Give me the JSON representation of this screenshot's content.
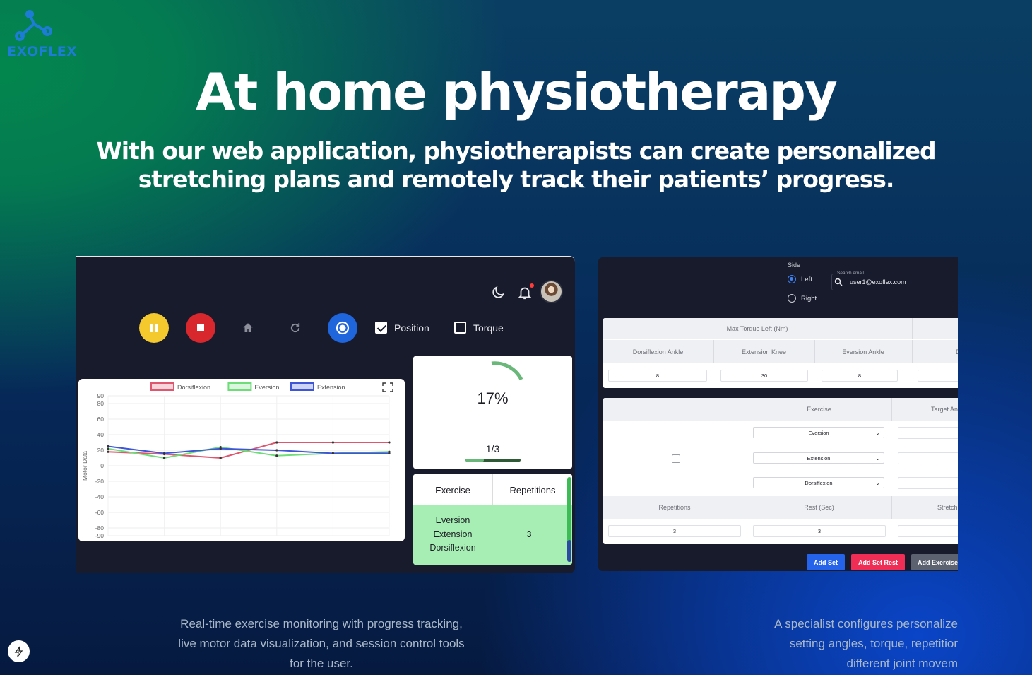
{
  "brand": {
    "name": "EXOFLEX"
  },
  "hero": {
    "title": "At home physiotherapy",
    "subtitle_line1": "With our web application, physiotherapists can create personalized",
    "subtitle_line2": "stretching plans and remotely track their patients’ progress."
  },
  "monitor": {
    "toggles": [
      {
        "label": "Position",
        "checked": true
      },
      {
        "label": "Torque",
        "checked": false
      }
    ],
    "progress": {
      "percent_label": "17%",
      "fraction_label": "1/3",
      "fraction": 0.33
    },
    "table": {
      "headers": [
        "Exercise",
        "Repetitions"
      ],
      "exercises": [
        "Eversion",
        "Extension",
        "Dorsiflexion"
      ],
      "repetitions": "3"
    }
  },
  "chart_data": {
    "type": "line",
    "ylabel": "Motor Data",
    "ylim": [
      -90,
      90
    ],
    "y_ticks": [
      90,
      80,
      60,
      40,
      20,
      0,
      -20,
      -40,
      -60,
      -80,
      -90
    ],
    "legend_position": "top",
    "grid": true,
    "x": [
      0,
      1,
      2,
      3,
      4,
      5
    ],
    "series": [
      {
        "name": "Dorsiflexion",
        "color": "#e0566e",
        "values": [
          18,
          15,
          10,
          30,
          30,
          30
        ]
      },
      {
        "name": "Eversion",
        "color": "#6fdc7a",
        "values": [
          22,
          10,
          24,
          13,
          16,
          18
        ]
      },
      {
        "name": "Extension",
        "color": "#3d55d6",
        "values": [
          25,
          16,
          22,
          20,
          16,
          16
        ]
      }
    ]
  },
  "config": {
    "side_label": "Side",
    "side_options": [
      {
        "label": "Left",
        "selected": true
      },
      {
        "label": "Right",
        "selected": false
      }
    ],
    "search": {
      "label": "Search email",
      "value": "user1@exoflex.com"
    },
    "torque_title": "Max Torque Left (Nm)",
    "torque_columns": [
      "Dorsiflexion Ankle",
      "Extension Knee",
      "Eversion Ankle",
      "Dorsi"
    ],
    "torque_values": [
      "8",
      "30",
      "8",
      ""
    ],
    "exercise_header": "Exercise",
    "target_header": "Target An",
    "exercise_options": [
      "Eversion",
      "Extension",
      "Dorsiflexion"
    ],
    "bottom_headers": [
      "Repetitions",
      "Rest (Sec)",
      "Stretch"
    ],
    "bottom_values": [
      "3",
      "3",
      ""
    ],
    "buttons": {
      "add_set": "Add Set",
      "add_set_rest": "Add Set Rest",
      "add_exercise": "Add Exercise"
    }
  },
  "captions": {
    "left_line1": "Real-time exercise monitoring with progress tracking,",
    "left_line2": "live motor data visualization, and session control tools",
    "left_line3": "for the user.",
    "right_line1": "A specialist configures personalize",
    "right_line2": "setting angles, torque, repetitior",
    "right_line3": "different joint movem"
  },
  "colors": {
    "accent_blue": "#1f65dc",
    "pause_yellow": "#f3c92e",
    "stop_red": "#d9272e",
    "table_green": "#a7eeb4"
  }
}
